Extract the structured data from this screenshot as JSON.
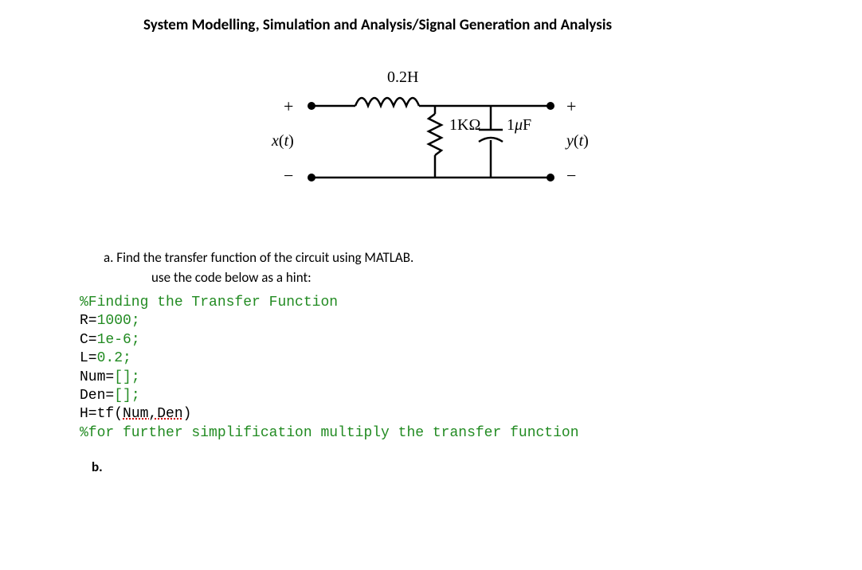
{
  "title": "System Modelling, Simulation and Analysis/Signal Generation and Analysis",
  "circuit": {
    "inductor_label": "0.2H",
    "resistor_label": "1KΩ",
    "capacitor_label": "1μF",
    "input_label": "x(t)",
    "output_label": "y(t)",
    "plus": "+",
    "minus": "−"
  },
  "question_a": "a. Find the transfer function of the circuit using MATLAB.",
  "question_a_sub": "use the code below as a hint:",
  "code": {
    "line1": "%Finding the Transfer Function",
    "line2_pre": "R=",
    "line2_val": "1000;",
    "line3_pre": "C=",
    "line3_val": "1e-6;",
    "line4_pre": "L=",
    "line4_val": "0.2;",
    "line5_pre": "Num=",
    "line5_val": "[];",
    "line6_pre": "Den=",
    "line6_val": "[];",
    "line7_pre": "H=tf(",
    "line7_mid": "Num,Den",
    "line7_post": ")",
    "line8": "%for further simplification multiply the transfer function"
  },
  "part_b": "b."
}
